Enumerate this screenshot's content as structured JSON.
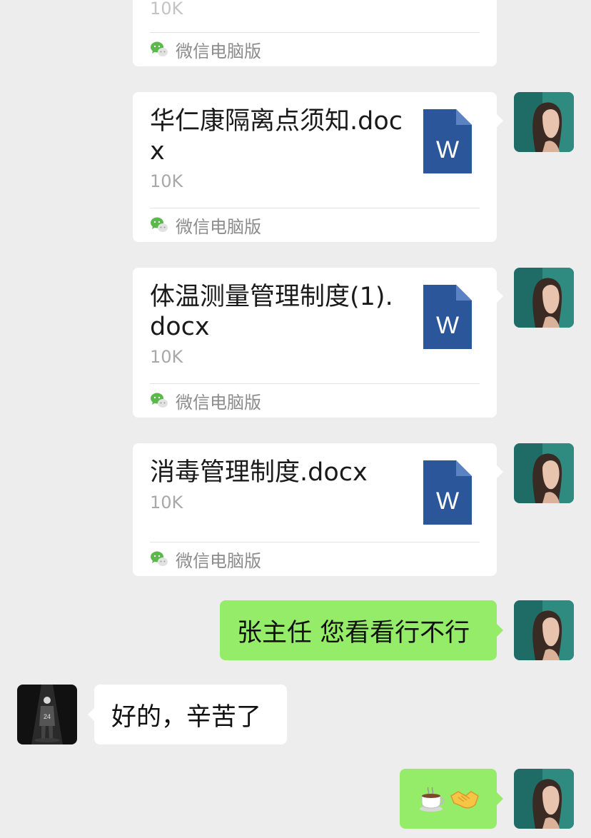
{
  "colors": {
    "chat_background": "#ededed",
    "sent_bubble": "#95ec69",
    "received_bubble": "#ffffff",
    "word_blue": "#2b579a"
  },
  "messages": [
    {
      "type": "file",
      "direction": "sent",
      "size": "10K",
      "source": "微信电脑版",
      "icon": "word-file-icon"
    },
    {
      "type": "file",
      "direction": "sent",
      "file_name": "华仁康隔离点须知.docx",
      "size": "10K",
      "source": "微信电脑版",
      "icon": "word-file-icon"
    },
    {
      "type": "file",
      "direction": "sent",
      "file_name": "体温测量管理制度(1).docx",
      "size": "10K",
      "source": "微信电脑版",
      "icon": "word-file-icon"
    },
    {
      "type": "file",
      "direction": "sent",
      "file_name": "消毒管理制度.docx",
      "size": "10K",
      "source": "微信电脑版",
      "icon": "word-file-icon"
    },
    {
      "type": "text",
      "direction": "sent",
      "text": "张主任 您看看行不行"
    },
    {
      "type": "text",
      "direction": "received",
      "text": "好的，辛苦了"
    },
    {
      "type": "emoji",
      "direction": "sent",
      "emojis": [
        "coffee-icon",
        "handshake-icon"
      ]
    }
  ]
}
